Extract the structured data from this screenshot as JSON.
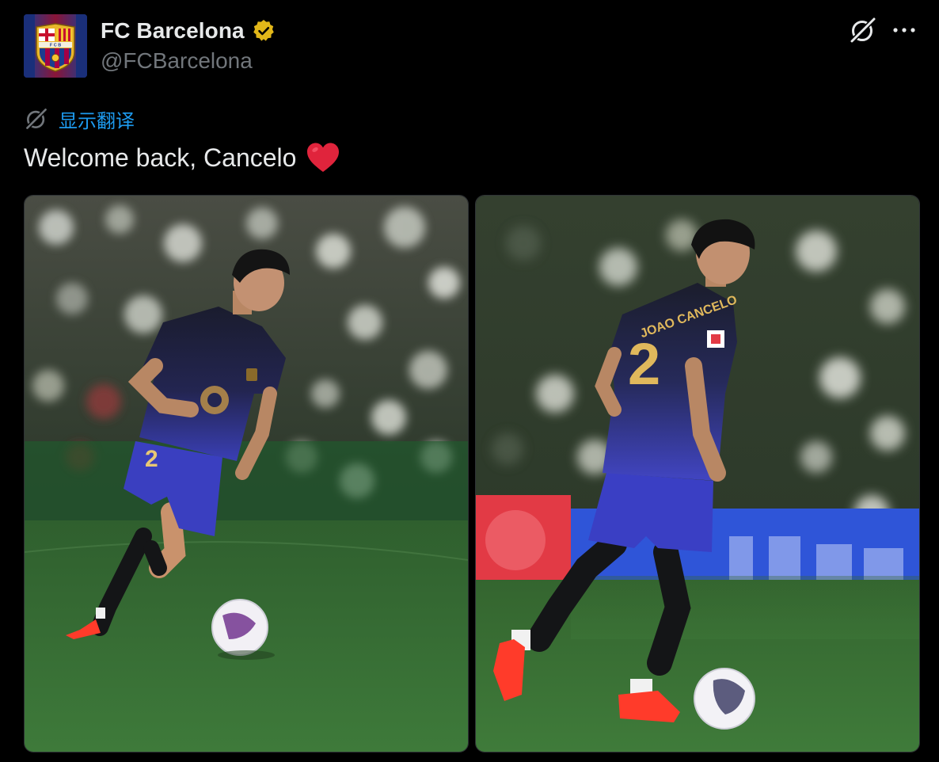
{
  "account": {
    "display_name": "FC Barcelona",
    "handle": "@FCBarcelona",
    "verified_icon": "verified-badge-gold",
    "avatar_icon": "fc-barcelona-crest",
    "crest_text": "F C B"
  },
  "actions": {
    "grok_icon": "grok-icon",
    "more_icon": "more-horizontal-icon"
  },
  "translate": {
    "icon": "grok-translate-icon",
    "label": "显示翻译"
  },
  "tweet": {
    "text": "Welcome back, Cancelo",
    "emoji": "red-heart-emoji"
  },
  "media": {
    "photos": [
      {
        "name": "photo-left",
        "player_number": "2"
      },
      {
        "name": "photo-right",
        "player_number": "2",
        "player_name_on_shirt": "JOAO CANCELO"
      }
    ]
  },
  "colors": {
    "background": "#000000",
    "text_primary": "#e7e9ea",
    "text_secondary": "#71767b",
    "link_blue": "#1d9bf0",
    "verified_gold": "#e2b719",
    "heart_red": "#e0243c",
    "pitch_green": "#3d7a3a",
    "kit_navy": "#1d1f3a",
    "kit_blue": "#3b3fb8"
  }
}
